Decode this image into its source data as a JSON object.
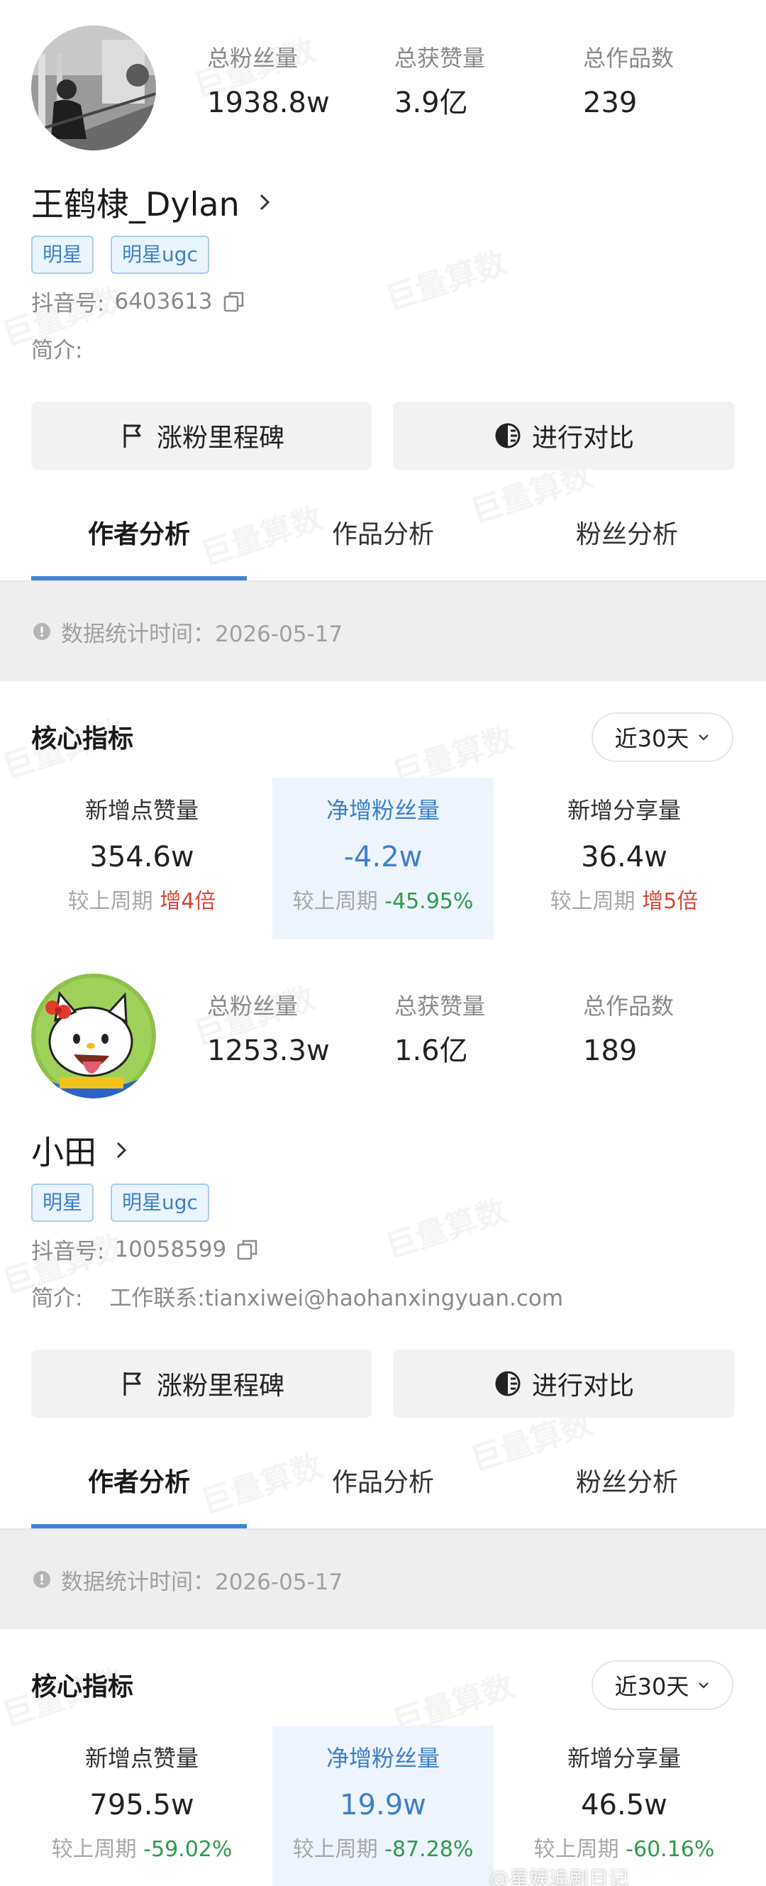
{
  "cards": [
    {
      "stats": [
        {
          "label": "总粉丝量",
          "value": "1938.8w"
        },
        {
          "label": "总获赞量",
          "value": "3.9亿"
        },
        {
          "label": "总作品数",
          "value": "239"
        }
      ],
      "name": "王鹤棣_Dylan",
      "tags": [
        "明星",
        "明星ugc"
      ],
      "douyin_label": "抖音号:",
      "douyin_id": "6403613",
      "bio_label": "简介:",
      "bio": "",
      "buttons": {
        "milestone": "涨粉里程碑",
        "compare": "进行对比"
      },
      "tabs": [
        "作者分析",
        "作品分析",
        "粉丝分析"
      ],
      "stat_time": "数据统计时间：2026-05-17",
      "core_title": "核心指标",
      "range": "近30天",
      "metrics": [
        {
          "label": "新增点赞量",
          "value": "354.6w",
          "cmp_label": "较上周期",
          "cmp_value": "增4倍",
          "trend": "up"
        },
        {
          "label": "净增粉丝量",
          "value": "-4.2w",
          "cmp_label": "较上周期",
          "cmp_value": "-45.95%",
          "trend": "down"
        },
        {
          "label": "新增分享量",
          "value": "36.4w",
          "cmp_label": "较上周期",
          "cmp_value": "增5倍",
          "trend": "up"
        }
      ]
    },
    {
      "stats": [
        {
          "label": "总粉丝量",
          "value": "1253.3w"
        },
        {
          "label": "总获赞量",
          "value": "1.6亿"
        },
        {
          "label": "总作品数",
          "value": "189"
        }
      ],
      "name": "小田",
      "tags": [
        "明星",
        "明星ugc"
      ],
      "douyin_label": "抖音号:",
      "douyin_id": "10058599",
      "bio_label": "简介:",
      "bio": "工作联系:tianxiwei@haohanxingyuan.com",
      "buttons": {
        "milestone": "涨粉里程碑",
        "compare": "进行对比"
      },
      "tabs": [
        "作者分析",
        "作品分析",
        "粉丝分析"
      ],
      "stat_time": "数据统计时间：2026-05-17",
      "core_title": "核心指标",
      "range": "近30天",
      "metrics": [
        {
          "label": "新增点赞量",
          "value": "795.5w",
          "cmp_label": "较上周期",
          "cmp_value": "-59.02%",
          "trend": "down"
        },
        {
          "label": "净增粉丝量",
          "value": "19.9w",
          "cmp_label": "较上周期",
          "cmp_value": "-87.28%",
          "trend": "down"
        },
        {
          "label": "新增分享量",
          "value": "46.5w",
          "cmp_label": "较上周期",
          "cmp_value": "-60.16%",
          "trend": "down"
        }
      ]
    }
  ],
  "watermark": "巨量算数",
  "footer_watermark": "@星娱追剧日记",
  "colors": {
    "accent": "#3f82d8",
    "up": "#d9463a",
    "down": "#2e9b4b",
    "tag_bg": "#eaf4fe"
  }
}
